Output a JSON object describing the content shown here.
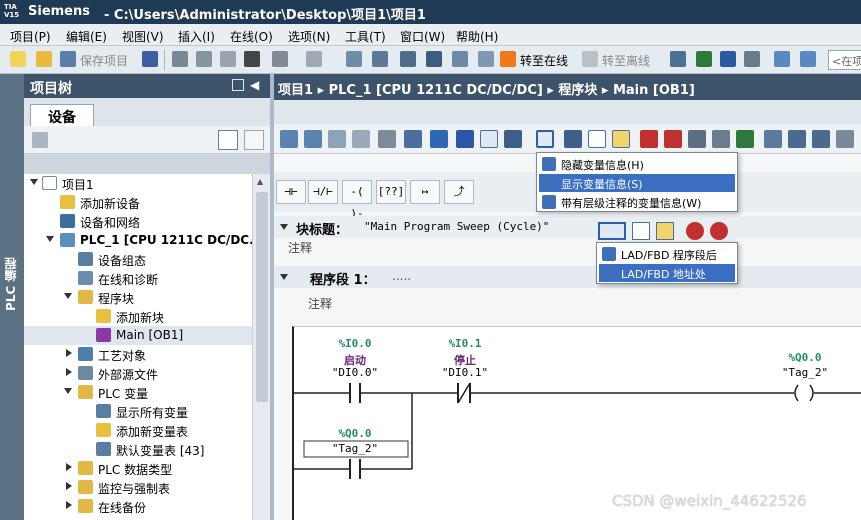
{
  "window": {
    "logo_top": "TIA",
    "logo_bottom": "V15",
    "app_name": "Siemens",
    "title_path": "-   C:\\Users\\Administrator\\Desktop\\项目1\\项目1"
  },
  "menu": [
    "项目(P)",
    "编辑(E)",
    "视图(V)",
    "插入(I)",
    "在线(O)",
    "选项(N)",
    "工具(T)",
    "窗口(W)",
    "帮助(H)"
  ],
  "toolbar": {
    "save_project": "保存项目",
    "go_online": "转至在线",
    "go_offline": "转至离线",
    "search_placeholder": "<在项"
  },
  "side_strip": {
    "label": "PLC 编程"
  },
  "project_tree": {
    "title": "项目树",
    "tab": "设备",
    "items": [
      {
        "label": "项目1"
      },
      {
        "label": "添加新设备"
      },
      {
        "label": "设备和网络"
      },
      {
        "label": "PLC_1 [CPU 1211C DC/DC..."
      },
      {
        "label": "设备组态"
      },
      {
        "label": "在线和诊断"
      },
      {
        "label": "程序块"
      },
      {
        "label": "添加新块"
      },
      {
        "label": "Main [OB1]"
      },
      {
        "label": "工艺对象"
      },
      {
        "label": "外部源文件"
      },
      {
        "label": "PLC 变量"
      },
      {
        "label": "显示所有变量"
      },
      {
        "label": "添加新变量表"
      },
      {
        "label": "默认变量表 [43]"
      },
      {
        "label": "PLC 数据类型"
      },
      {
        "label": "监控与强制表"
      },
      {
        "label": "在线备份"
      }
    ]
  },
  "editor": {
    "breadcrumb": "项目1  ▸  PLC_1 [CPU 1211C DC/DC/DC]  ▸  程序块  ▸  Main [OB1]",
    "block_title_label": "块标题：",
    "block_title_value": "\"Main Program Sweep (Cycle)\"",
    "block_comment": "注释",
    "network_label": "程序段 1：",
    "network_dots": ".....",
    "network_comment": "注释",
    "ladder": {
      "contact1_addr": "%I0.0",
      "contact1_sym": "启动",
      "contact1_tag": "\"DI0.0\"",
      "contact2_addr": "%I0.1",
      "contact2_sym": "停止",
      "contact2_tag": "\"DI0.1\"",
      "coil_addr": "%Q0.0",
      "coil_tag": "\"Tag_2\"",
      "branch_addr": "%Q0.0",
      "branch_tag": "\"Tag_2\""
    }
  },
  "dropdown_variable_info": [
    {
      "label": "隐藏变量信息(H)",
      "highlighted": false
    },
    {
      "label": "显示变量信息(S)",
      "highlighted": true
    },
    {
      "label": "带有层级注释的变量信息(W)",
      "highlighted": false
    }
  ],
  "dropdown_ladder_view": [
    {
      "label": "LAD/FBD 程序段后",
      "highlighted": false
    },
    {
      "label": "LAD/FBD 地址处",
      "highlighted": true
    }
  ],
  "watermark": "CSDN @weixin_44622526"
}
